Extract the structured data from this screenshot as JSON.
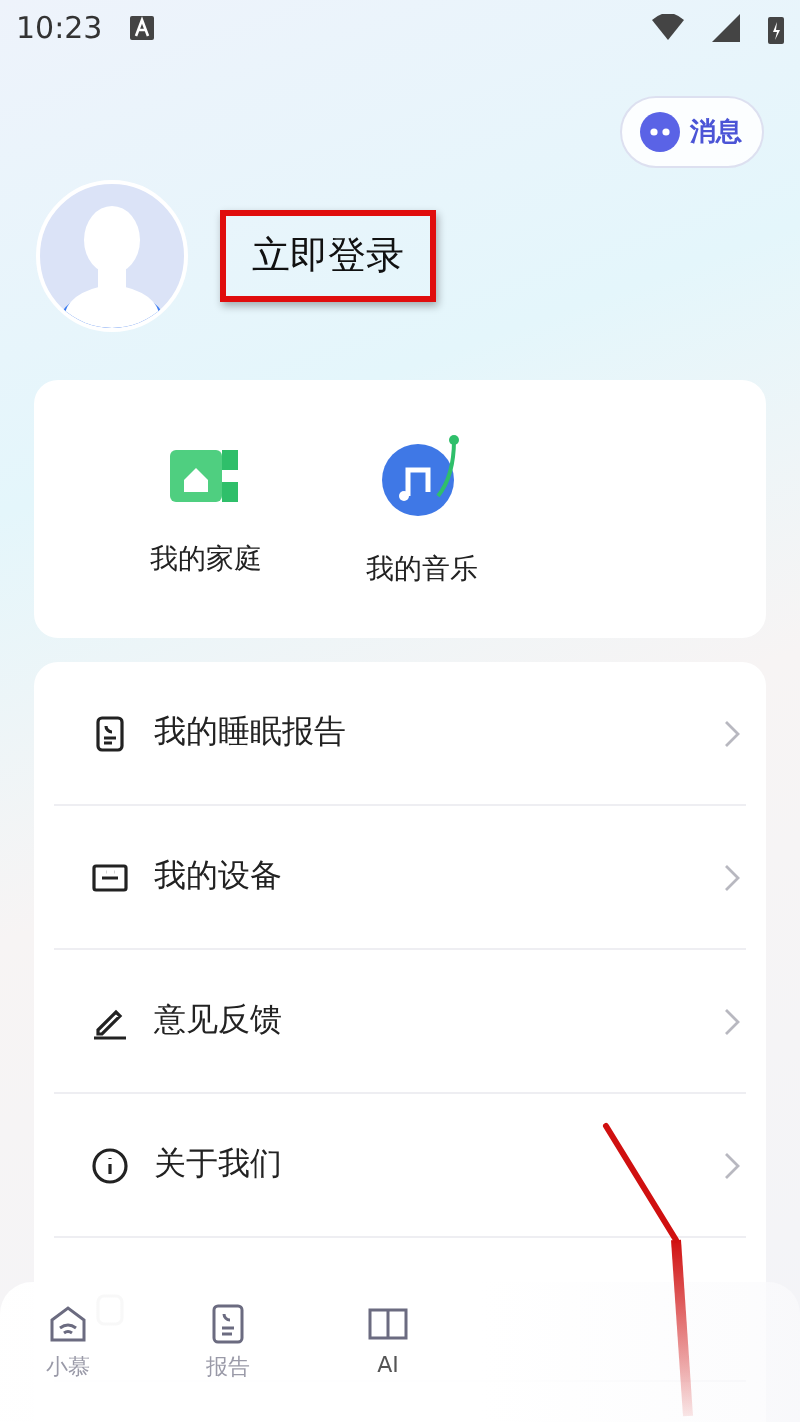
{
  "status_bar": {
    "time": "10:23"
  },
  "message_button": {
    "label": "消息"
  },
  "profile": {
    "login_label": "立即登录"
  },
  "shortcuts": [
    {
      "kind": "family",
      "label": "我的家庭"
    },
    {
      "kind": "music",
      "label": "我的音乐"
    }
  ],
  "menu": [
    {
      "kind": "sleep",
      "label": "我的睡眠报告"
    },
    {
      "kind": "device",
      "label": "我的设备"
    },
    {
      "kind": "feedback",
      "label": "意见反馈"
    },
    {
      "kind": "about",
      "label": "关于我们"
    },
    {
      "kind": "settings"
    }
  ],
  "bottom_nav": [
    {
      "kind": "home",
      "label": "小慕",
      "selected": false
    },
    {
      "kind": "report",
      "label": "报告",
      "selected": false
    },
    {
      "kind": "ai",
      "label": "AI",
      "selected": true
    }
  ]
}
